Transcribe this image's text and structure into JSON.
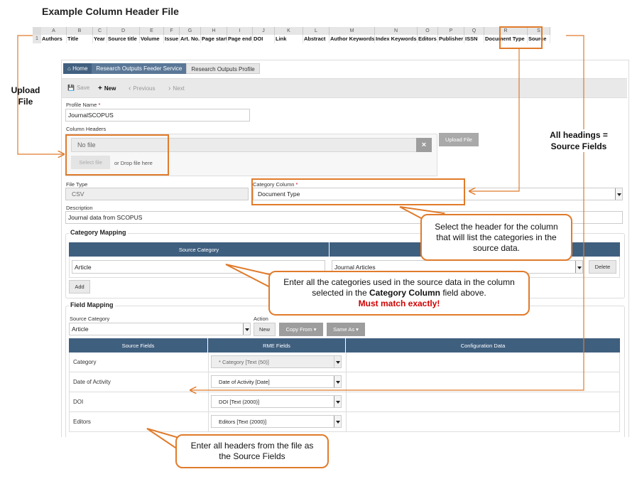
{
  "title": "Example Column Header File",
  "spreadsheet": {
    "row_number": "1",
    "columns": [
      {
        "letter": "A",
        "header": "Authors"
      },
      {
        "letter": "B",
        "header": "Title"
      },
      {
        "letter": "C",
        "header": "Year"
      },
      {
        "letter": "D",
        "header": "Source title"
      },
      {
        "letter": "E",
        "header": "Volume"
      },
      {
        "letter": "F",
        "header": "Issue"
      },
      {
        "letter": "G",
        "header": "Art. No."
      },
      {
        "letter": "H",
        "header": "Page start"
      },
      {
        "letter": "I",
        "header": "Page end"
      },
      {
        "letter": "J",
        "header": "DOI"
      },
      {
        "letter": "K",
        "header": "Link"
      },
      {
        "letter": "L",
        "header": "Abstract"
      },
      {
        "letter": "M",
        "header": "Author Keywords"
      },
      {
        "letter": "N",
        "header": "Index Keywords"
      },
      {
        "letter": "O",
        "header": "Editors"
      },
      {
        "letter": "P",
        "header": "Publisher"
      },
      {
        "letter": "Q",
        "header": "ISSN"
      },
      {
        "letter": "R",
        "header": "Document Type"
      },
      {
        "letter": "S",
        "header": "Source"
      }
    ]
  },
  "breadcrumb": {
    "home": "Home",
    "level2": "Research Outputs Feeder Service",
    "level3": "Research Outputs Profile"
  },
  "toolbar": {
    "save": "Save",
    "new": "New",
    "previous": "Previous",
    "next": "Next"
  },
  "form": {
    "profile_name_label": "Profile Name",
    "profile_name_value": "JournalSCOPUS",
    "column_headers_label": "Column Headers",
    "file_status": "No file",
    "select_file": "Select file",
    "drop_hint": "or Drop file here",
    "upload_file": "Upload File",
    "file_type_label": "File Type",
    "file_type_value": "CSV",
    "category_column_label": "Category Column",
    "category_column_value": "Document Type",
    "description_label": "Description",
    "description_value": "Journal data from SCOPUS"
  },
  "category_mapping": {
    "section": "Category Mapping",
    "col_source": "Source Category",
    "source_value": "Article",
    "target_value": "Journal Articles",
    "delete": "Delete",
    "add": "Add"
  },
  "field_mapping": {
    "section": "Field Mapping",
    "source_category_label": "Source Category",
    "source_category_value": "Article",
    "action_label": "Action",
    "new": "New",
    "copy_from": "Copy From",
    "same_as": "Same As",
    "columns": [
      "Source Fields",
      "RME Fields",
      "Configuration Data"
    ],
    "rows": [
      {
        "source": "Category",
        "rme": "* Category [Text (50)]"
      },
      {
        "source": "Date of Activity",
        "rme": "Date of Activity [Date]"
      },
      {
        "source": "DOI",
        "rme": "DOI [Text (2000)]"
      },
      {
        "source": "Editors",
        "rme": "Editors [Text (2000)]"
      }
    ]
  },
  "annotations": {
    "upload_line1": "Upload",
    "upload_line2": "File",
    "headings_line1": "All headings =",
    "headings_line2": "Source Fields",
    "callout_header": "Select the header for the column that will list the categories in the source data.",
    "callout_categories_pre": "Enter all the categories used in the source data in the column selected in the ",
    "callout_categories_bold": "Category Column",
    "callout_categories_post": " field above.",
    "callout_categories_warn": "Must match exactly!",
    "callout_fields": "Enter all headers from the file as the Source Fields"
  },
  "colors": {
    "accent": "#e07b2b",
    "header_blue": "#3f5f7f",
    "warning_red": "#d10000"
  }
}
